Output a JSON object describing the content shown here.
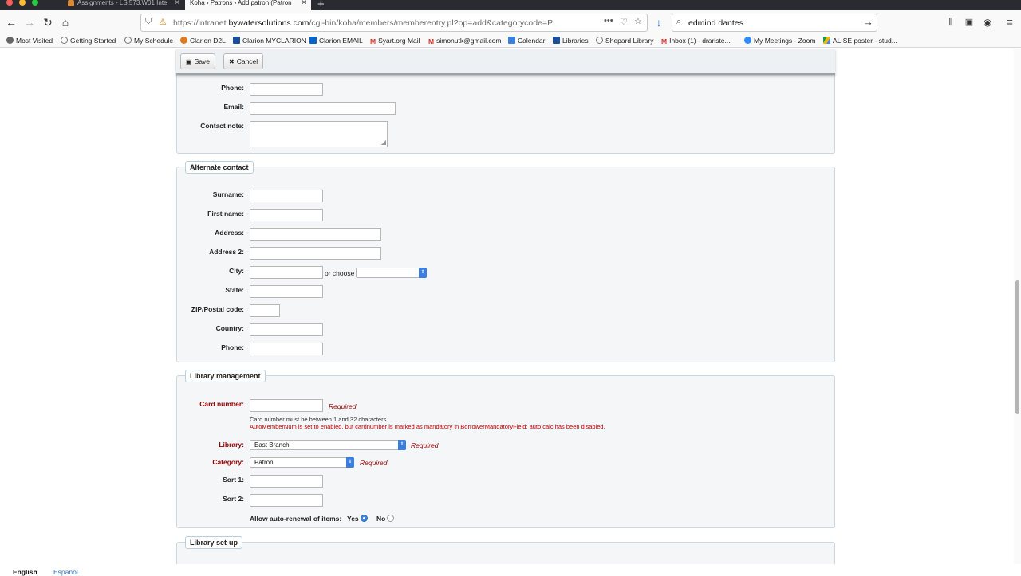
{
  "browser": {
    "tabs": [
      {
        "title": "Assignments - LS.573.W01 Inte"
      },
      {
        "title": "Koha › Patrons › Add patron (Patron"
      }
    ],
    "new_tab": "+",
    "url_domain_prefix": "https://intranet.",
    "url_domain": "bywatersolutions.com",
    "url_path": "/cgi-bin/koha/members/memberentry.pl?op=add&categorycode=P",
    "search_value": "edmind dantes",
    "bookmarks": [
      {
        "label": "Most Visited",
        "icon": "gear-icon",
        "color": "#555555"
      },
      {
        "label": "Getting Started",
        "icon": "globe-icon",
        "color": "#777777"
      },
      {
        "label": "My Schedule",
        "icon": "globe-icon",
        "color": "#777777"
      },
      {
        "label": "Clarion D2L",
        "icon": "d2l-icon",
        "color": "#e07a1f"
      },
      {
        "label": "Clarion MYCLARION",
        "icon": "clarion-icon",
        "color": "#1b4f9c"
      },
      {
        "label": "Clarion EMAIL",
        "icon": "outlook-icon",
        "color": "#0a64c8"
      },
      {
        "label": "Syart.org Mail",
        "icon": "gmail-icon",
        "color": "#d93025"
      },
      {
        "label": "simonutk@gmail.com",
        "icon": "gmail-icon",
        "color": "#d93025"
      },
      {
        "label": "Calendar",
        "icon": "calendar-icon",
        "color": "#3a7ee0"
      },
      {
        "label": "Libraries",
        "icon": "clarion-icon",
        "color": "#1b4f9c"
      },
      {
        "label": "Shepard Library",
        "icon": "globe-icon",
        "color": "#777777"
      },
      {
        "label": "Inbox (1) - drariste...",
        "icon": "gmail-icon",
        "color": "#d93025"
      },
      {
        "label": "My Meetings - Zoom",
        "icon": "zoom-icon",
        "color": "#2d8cff"
      },
      {
        "label": "ALISE poster - stud...",
        "icon": "drive-icon",
        "color": "#f4b400"
      }
    ]
  },
  "toolbar": {
    "save_label": "Save",
    "cancel_label": "Cancel"
  },
  "contact_tail": {
    "phone_label": "Phone:",
    "email_label": "Email:",
    "contact_note_label": "Contact note:"
  },
  "alternate_contact": {
    "legend": "Alternate contact",
    "surname_label": "Surname:",
    "firstname_label": "First name:",
    "address_label": "Address:",
    "address2_label": "Address 2:",
    "city_label": "City:",
    "or_choose": "or choose",
    "state_label": "State:",
    "zip_label": "ZIP/Postal code:",
    "country_label": "Country:",
    "phone_label": "Phone:"
  },
  "library_management": {
    "legend": "Library management",
    "card_number_label": "Card number:",
    "required": "Required",
    "card_hint": "Card number must be between 1 and 32 characters.",
    "card_warning": "AutoMemberNum is set to enabled, but cardnumber is marked as mandatory in BorrowerMandatoryField: auto calc has been disabled.",
    "library_label": "Library:",
    "library_value": "East Branch",
    "category_label": "Category:",
    "category_value": "Patron",
    "sort1_label": "Sort 1:",
    "sort2_label": "Sort 2:",
    "auto_renewal_label": "Allow auto-renewal of items:",
    "yes_label": "Yes",
    "no_label": "No",
    "auto_renewal_value": "Yes"
  },
  "library_setup": {
    "legend": "Library set-up"
  },
  "languages": {
    "current": "English",
    "other": "Español"
  }
}
